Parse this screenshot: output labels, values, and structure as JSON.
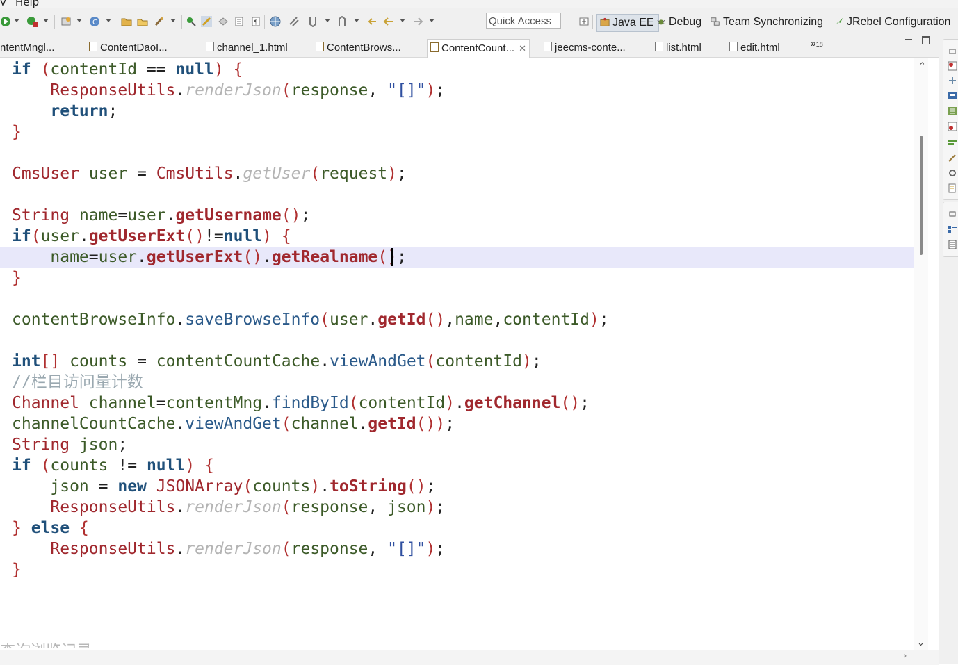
{
  "menu": {
    "items": [
      "v",
      "Help"
    ]
  },
  "toolbar": {
    "quick_access_placeholder": "Quick Access",
    "perspectives": [
      {
        "label": "Java EE",
        "icon": "java-ee-perspective-icon",
        "active": true
      },
      {
        "label": "Debug",
        "icon": "debug-perspective-icon",
        "active": false
      },
      {
        "label": "Team Synchronizing",
        "icon": "team-sync-perspective-icon",
        "active": false
      },
      {
        "label": "JRebel Configuration",
        "icon": "jrebel-perspective-icon",
        "active": false
      }
    ]
  },
  "tabs": [
    {
      "label": "ntentMngl...",
      "icon": "java-file-icon",
      "active": false
    },
    {
      "label": "ContentDaoI...",
      "icon": "java-file-icon",
      "active": false
    },
    {
      "label": "channel_1.html",
      "icon": "html-file-icon",
      "active": false
    },
    {
      "label": "ContentBrows...",
      "icon": "java-file-icon",
      "active": false
    },
    {
      "label": "ContentCount...",
      "icon": "java-file-icon",
      "active": true
    },
    {
      "label": "jeecms-conte...",
      "icon": "xml-file-icon",
      "active": false
    },
    {
      "label": "list.html",
      "icon": "html-file-icon",
      "active": false
    },
    {
      "label": "edit.html",
      "icon": "html-file-icon",
      "active": false
    }
  ],
  "overflow_tabs": {
    "symbol": "»",
    "count": "18"
  },
  "editor": {
    "faded_comment": "查询浏览记录",
    "code_lines": [
      "if (contentId == null) {",
      "    ResponseUtils.renderJson(response, \"[]\");",
      "    return;",
      "}",
      "",
      "CmsUser user = CmsUtils.getUser(request);",
      "",
      "String name=user.getUsername();",
      "if(user.getUserExt()!=null) {",
      "    name=user.getUserExt().getRealname();",
      "}",
      "",
      "contentBrowseInfo.saveBrowseInfo(user.getId(),name,contentId);",
      "",
      "int[] counts = contentCountCache.viewAndGet(contentId);",
      "//栏目访问量计数",
      "Channel channel=contentMng.findById(contentId).getChannel();",
      "channelCountCache.viewAndGet(channel.getId());",
      "String json;",
      "if (counts != null) {",
      "    json = new JSONArray(counts).toString();",
      "    ResponseUtils.renderJson(response, json);",
      "} else {",
      "    ResponseUtils.renderJson(response, \"[]\");",
      "}"
    ],
    "current_line": 10,
    "caret_line": 10
  },
  "colors": {
    "keyword": "#20507a",
    "type": "#a0282e",
    "variable": "#3c5a28",
    "method": "#2b5a8a",
    "string": "#3050a0",
    "static_method": "#b4b4b4",
    "comment": "#9aa8b0",
    "current_line_bg": "#e8e8fa"
  }
}
